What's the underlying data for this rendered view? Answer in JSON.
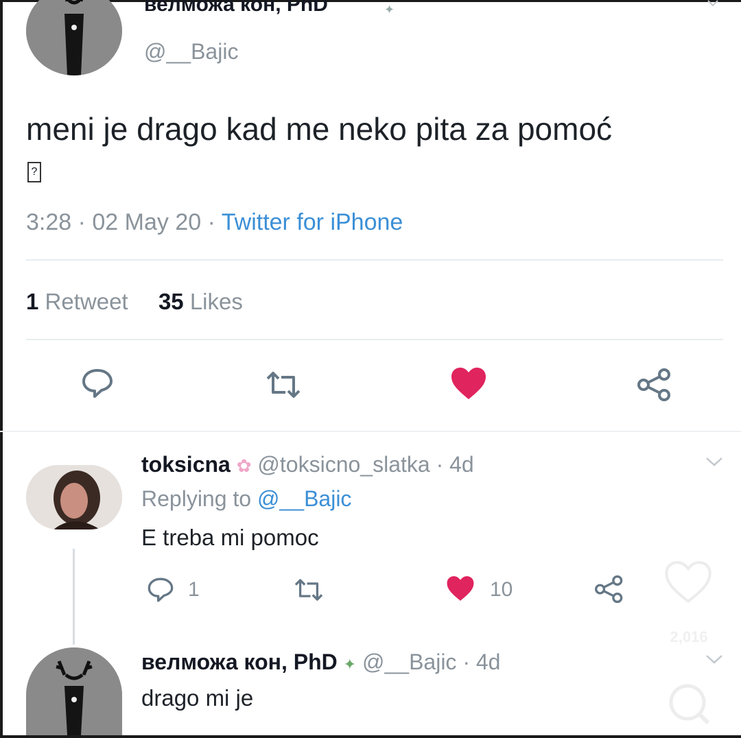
{
  "main_tweet": {
    "display_name": "велможа кон, PhD",
    "handle": "@__Bajic",
    "text": "meni je drago kad me neko pita za pomoć",
    "emoji_glyph": "?",
    "time": "3:28 · 02 May 20 · ",
    "source": "Twitter for iPhone",
    "retweets_count": "1",
    "retweets_label": "Retweet",
    "likes_count": "35",
    "likes_label": "Likes"
  },
  "reply1": {
    "display_name": "toksicna",
    "handle": "@toksicno_slatka · 4d",
    "replying_prefix": "Replying to ",
    "replying_handle": "@__Bajic",
    "text": "E treba mi pomoc",
    "reply_count": "1",
    "like_count": "10"
  },
  "reply2": {
    "display_name": "велможа кон, PhD",
    "handle": "@__Bajic · 4d",
    "text": "drago mi je"
  },
  "overlay": {
    "like_count": "2,016"
  },
  "colors": {
    "heart": "#e0245e",
    "icon_gray": "#657786",
    "link_blue": "#3b8fd6"
  },
  "icons": [
    "reply-icon",
    "retweet-icon",
    "heart-icon",
    "share-icon",
    "chevron-down-icon",
    "search-icon"
  ]
}
